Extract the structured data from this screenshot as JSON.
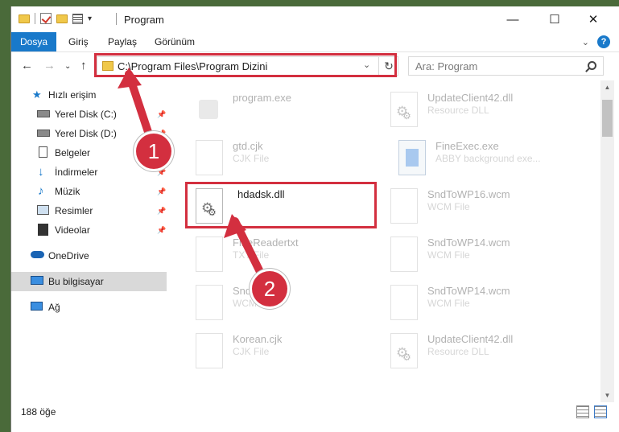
{
  "window": {
    "title": "Program",
    "min_glyph": "—",
    "max_glyph": "☐",
    "close_glyph": "✕"
  },
  "ribbon": {
    "tabs": [
      "Dosya",
      "Giriş",
      "Paylaş",
      "Görünüm"
    ],
    "help_glyph": "?",
    "collapse_glyph": "⌄"
  },
  "nav": {
    "back_glyph": "←",
    "forward_glyph": "→",
    "recent_glyph": "⌄",
    "up_glyph": "↑",
    "address": "C:\\Program Files\\Program Dizini",
    "address_dropdown_glyph": "⌄",
    "refresh_glyph": "↻",
    "search_placeholder": "Ara: Program"
  },
  "sidebar": {
    "items": [
      {
        "label": "Hızlı erişim",
        "icon": "star-icon",
        "pinned": false
      },
      {
        "label": "Yerel Disk (C:)",
        "icon": "drive-icon",
        "pinned": true
      },
      {
        "label": "Yerel Disk (D:)",
        "icon": "drive-icon",
        "pinned": true
      },
      {
        "label": "Belgeler",
        "icon": "document-icon",
        "pinned": true
      },
      {
        "label": "İndirmeler",
        "icon": "download-icon",
        "pinned": true
      },
      {
        "label": "Müzik",
        "icon": "music-icon",
        "pinned": true
      },
      {
        "label": "Resimler",
        "icon": "picture-icon",
        "pinned": true
      },
      {
        "label": "Videolar",
        "icon": "video-icon",
        "pinned": true
      },
      {
        "label": "OneDrive",
        "icon": "cloud-icon",
        "pinned": false
      },
      {
        "label": "Bu bilgisayar",
        "icon": "computer-icon",
        "pinned": false
      },
      {
        "label": "Ağ",
        "icon": "network-icon",
        "pinned": false
      }
    ],
    "selected": "Bu bilgisayar"
  },
  "files": [
    {
      "name": "program.exe",
      "type": "",
      "icon": "program-icon"
    },
    {
      "name": "UpdateClient42.dll",
      "type": "Resource DLL",
      "icon": "dll-icon"
    },
    {
      "name": "gtd.cjk",
      "type": "CJK File",
      "icon": "file-icon"
    },
    {
      "name": "FineExec.exe",
      "type": "ABBY background exe...",
      "icon": "exe-icon"
    },
    {
      "name": "hdadsk.dll",
      "type": "",
      "icon": "dll-icon"
    },
    {
      "name": "SndToWP16.wcm",
      "type": "WCM File",
      "icon": "file-icon"
    },
    {
      "name": "FineReadertxt",
      "type": "TXT File",
      "icon": "file-icon"
    },
    {
      "name": "SndToWP14.wcm",
      "type": "WCM File",
      "icon": "file-icon"
    },
    {
      "name": "SndT...wcm",
      "type": "WCM File",
      "icon": "file-icon"
    },
    {
      "name": "SndToWP14.wcm",
      "type": "WCM File",
      "icon": "file-icon"
    },
    {
      "name": "Korean.cjk",
      "type": "CJK File",
      "icon": "file-icon"
    },
    {
      "name": "UpdateClient42.dll",
      "type": "Resource DLL",
      "icon": "dll-icon"
    }
  ],
  "status": {
    "item_count": "188 öğe"
  },
  "annotations": {
    "step1": "1",
    "step2": "2",
    "color": "#d32f3f"
  }
}
